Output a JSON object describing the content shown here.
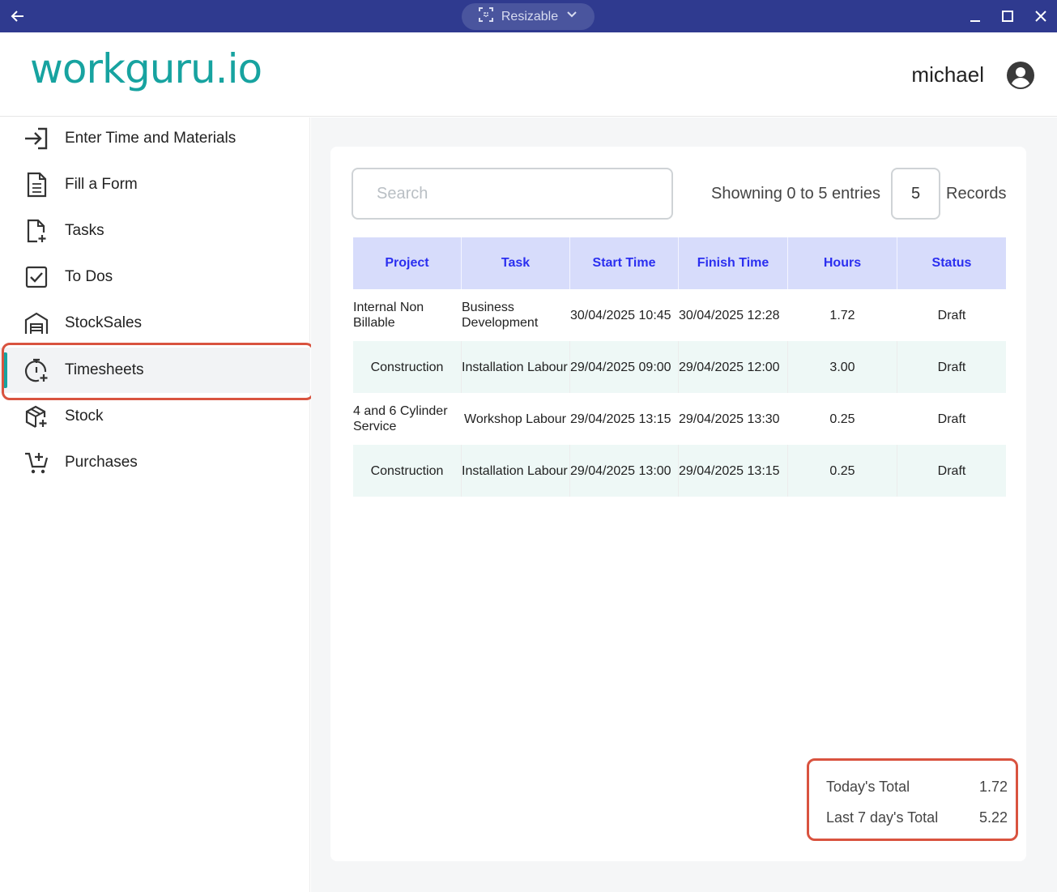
{
  "titlebar": {
    "mode_label": "Resizable"
  },
  "header": {
    "logo": "workguru.io",
    "username": "michael"
  },
  "sidebar": {
    "items": [
      {
        "label": "Enter Time and Materials",
        "icon": "enter-arrow-icon"
      },
      {
        "label": "Fill a Form",
        "icon": "document-icon"
      },
      {
        "label": "Tasks",
        "icon": "file-plus-icon"
      },
      {
        "label": "To Dos",
        "icon": "checkbox-icon"
      },
      {
        "label": "StockSales",
        "icon": "warehouse-icon"
      },
      {
        "label": "Timesheets",
        "icon": "stopwatch-plus-icon",
        "active": true
      },
      {
        "label": "Stock",
        "icon": "box-plus-icon"
      },
      {
        "label": "Purchases",
        "icon": "cart-plus-icon"
      }
    ]
  },
  "main": {
    "search_placeholder": "Search",
    "showing_text": "Showning 0 to 5 entries",
    "records_count": "5",
    "records_label": "Records"
  },
  "table": {
    "headers": [
      "Project",
      "Task",
      "Start Time",
      "Finish Time",
      "Hours",
      "Status"
    ],
    "rows": [
      {
        "project": "Internal Non Billable",
        "task": "Business Development",
        "start": "30/04/2025 10:45",
        "finish": "30/04/2025 12:28",
        "hours": "1.72",
        "status": "Draft"
      },
      {
        "project": "Construction",
        "task": "Installation Labour",
        "start": "29/04/2025 09:00",
        "finish": "29/04/2025 12:00",
        "hours": "3.00",
        "status": "Draft"
      },
      {
        "project": "4 and 6 Cylinder Service",
        "task": "Workshop Labour",
        "start": "29/04/2025 13:15",
        "finish": "29/04/2025 13:30",
        "hours": "0.25",
        "status": "Draft"
      },
      {
        "project": "Construction",
        "task": "Installation Labour",
        "start": "29/04/2025 13:00",
        "finish": "29/04/2025 13:15",
        "hours": "0.25",
        "status": "Draft"
      }
    ]
  },
  "totals": {
    "today_label": "Today's Total",
    "today_value": "1.72",
    "week_label": "Last 7 day's Total",
    "week_value": "5.22"
  },
  "colors": {
    "titlebar": "#2f3a8f",
    "brand": "#17a3a0",
    "header_row": "#d7dcfb",
    "header_text": "#2b2ff0",
    "alt_row": "#eef8f6",
    "highlight": "#d9533f"
  }
}
